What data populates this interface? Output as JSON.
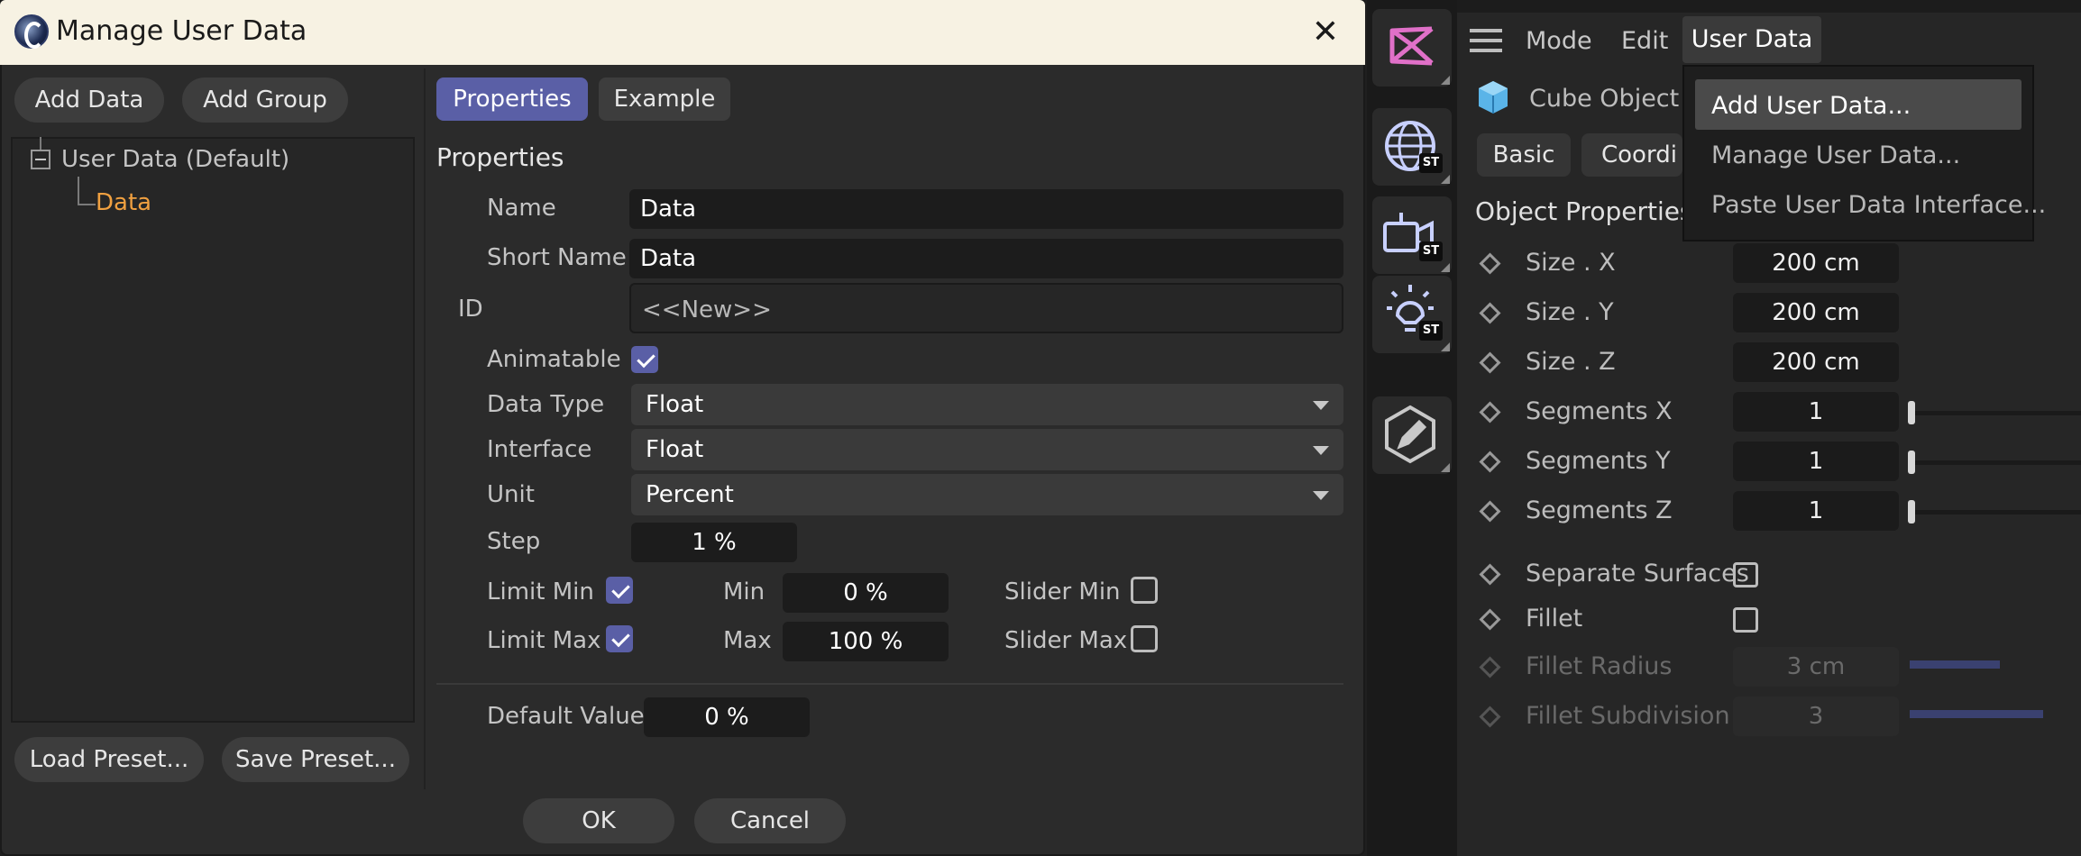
{
  "dialog": {
    "title": "Manage User Data",
    "buttons": {
      "add_data": "Add Data",
      "add_group": "Add Group",
      "load_preset": "Load Preset...",
      "save_preset": "Save Preset...",
      "ok": "OK",
      "cancel": "Cancel"
    },
    "tree": {
      "root": "User Data (Default)",
      "child": "Data",
      "child_color": "#f0a040"
    },
    "tabs": [
      {
        "label": "Properties",
        "active": true
      },
      {
        "label": "Example",
        "active": false
      }
    ],
    "section_title": "Properties",
    "fields": {
      "name_label": "Name",
      "name_value": "Data",
      "short_name_label": "Short Name",
      "short_name_value": "Data",
      "id_label": "ID",
      "id_value": "<<New>>",
      "animatable_label": "Animatable",
      "animatable_checked": true,
      "data_type_label": "Data Type",
      "data_type_value": "Float",
      "interface_label": "Interface",
      "interface_value": "Float",
      "unit_label": "Unit",
      "unit_value": "Percent",
      "step_label": "Step",
      "step_value": "1 %",
      "limit_min_label": "Limit Min",
      "limit_min_checked": true,
      "min_label": "Min",
      "min_value": "0 %",
      "slider_min_label": "Slider Min",
      "slider_min_checked": false,
      "limit_max_label": "Limit Max",
      "limit_max_checked": true,
      "max_label": "Max",
      "max_value": "100 %",
      "slider_max_label": "Slider Max",
      "slider_max_checked": false,
      "default_value_label": "Default Value",
      "default_value": "0 %"
    }
  },
  "toolstrip": {
    "icons": [
      "brand-logo-icon",
      "globe-st-icon",
      "camera-st-icon",
      "light-st-icon",
      "edit-hex-icon"
    ],
    "badge": "ST"
  },
  "attributes": {
    "menu": {
      "mode": "Mode",
      "edit": "Edit",
      "user_data": "User Data"
    },
    "dropdown": [
      "Add User Data...",
      "Manage User Data...",
      "Paste User Data Interface..."
    ],
    "object_title": "Cube Object [",
    "tabs": [
      "Basic",
      "Coordi"
    ],
    "section_title": "Object Properties",
    "rows": [
      {
        "label": "Size . X",
        "value": "200 cm"
      },
      {
        "label": "Size . Y",
        "value": "200 cm"
      },
      {
        "label": "Size . Z",
        "value": "200 cm"
      },
      {
        "label": "Segments X",
        "value": "1"
      },
      {
        "label": "Segments Y",
        "value": "1"
      },
      {
        "label": "Segments Z",
        "value": "1"
      }
    ],
    "separate_surfaces": "Separate Surfaces",
    "fillet": "Fillet",
    "fillet_radius_label": "Fillet Radius",
    "fillet_radius_value": "3 cm",
    "fillet_subdivision_label": "Fillet Subdivision",
    "fillet_subdivision_value": "3"
  }
}
